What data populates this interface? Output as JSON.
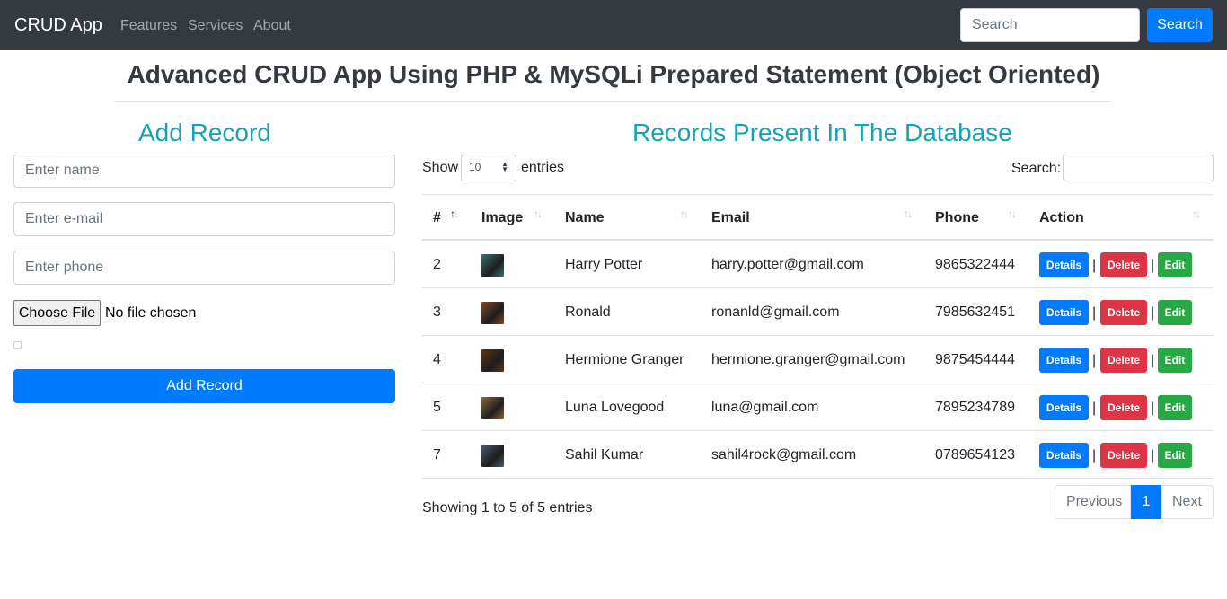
{
  "navbar": {
    "brand": "CRUD App",
    "links": [
      "Features",
      "Services",
      "About"
    ],
    "search_placeholder": "Search",
    "search_button": "Search"
  },
  "page_title": "Advanced CRUD App Using PHP & MySQLi Prepared Statement (Object Oriented)",
  "form": {
    "heading": "Add Record",
    "name_placeholder": "Enter name",
    "email_placeholder": "Enter e-mail",
    "phone_placeholder": "Enter phone",
    "file_button": "Choose File",
    "file_status": "No file chosen",
    "submit": "Add Record"
  },
  "records": {
    "heading": "Records Present In The Database",
    "show_label": "Show",
    "entries_label": "entries",
    "page_length": "10",
    "search_label": "Search:",
    "columns": [
      "#",
      "Image",
      "Name",
      "Email",
      "Phone",
      "Action"
    ],
    "rows": [
      {
        "id": "2",
        "name": "Harry Potter",
        "email": "harry.potter@gmail.com",
        "phone": "9865322444",
        "thumb_color": "#3c6e72"
      },
      {
        "id": "3",
        "name": "Ronald",
        "email": "ronanld@gmail.com",
        "phone": "7985632451",
        "thumb_color": "#7a4a2a"
      },
      {
        "id": "4",
        "name": "Hermione Granger",
        "email": "hermione.granger@gmail.com",
        "phone": "9875454444",
        "thumb_color": "#5a3418"
      },
      {
        "id": "5",
        "name": "Luna Lovegood",
        "email": "luna@gmail.com",
        "phone": "7895234789",
        "thumb_color": "#8a6a40"
      },
      {
        "id": "7",
        "name": "Sahil Kumar",
        "email": "sahil4rock@gmail.com",
        "phone": "0789654123",
        "thumb_color": "#4a5a6a"
      }
    ],
    "actions": {
      "details": "Details",
      "delete": "Delete",
      "edit": "Edit",
      "separator": "|"
    },
    "info": "Showing 1 to 5 of 5 entries",
    "pagination": {
      "previous": "Previous",
      "current": "1",
      "next": "Next"
    }
  },
  "colors": {
    "navbar": "#343a40",
    "primary": "#007bff",
    "danger": "#dc3545",
    "success": "#28a745",
    "heading": "#17a2b8"
  }
}
